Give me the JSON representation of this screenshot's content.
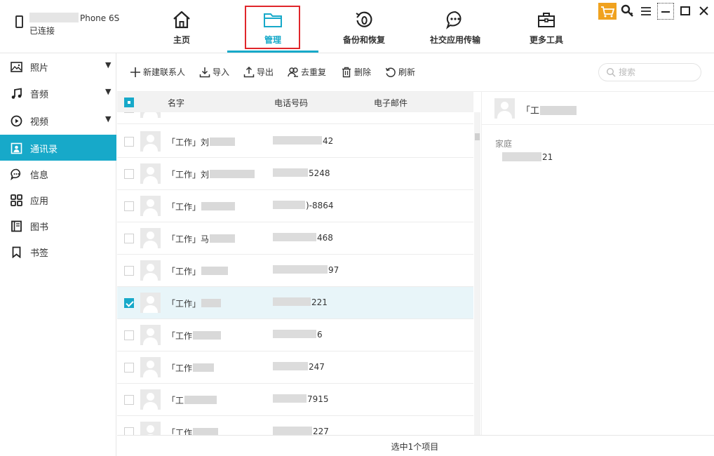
{
  "device": {
    "model": "Phone 6S",
    "status": "已连接"
  },
  "nav_tabs": [
    {
      "label": "主页",
      "icon": "home-icon"
    },
    {
      "label": "管理",
      "icon": "folder-icon"
    },
    {
      "label": "备份和恢复",
      "icon": "backup-restore-icon"
    },
    {
      "label": "社交应用传输",
      "icon": "chat-transfer-icon"
    },
    {
      "label": "更多工具",
      "icon": "toolbox-icon"
    }
  ],
  "active_tab": "管理",
  "window_controls": [
    "cart-icon",
    "key-icon",
    "menu-icon",
    "minimize-icon",
    "maximize-icon",
    "close-icon"
  ],
  "sidebar": {
    "items": [
      {
        "label": "照片",
        "icon": "photo-icon",
        "expandable": true
      },
      {
        "label": "音频",
        "icon": "music-icon",
        "expandable": true
      },
      {
        "label": "视频",
        "icon": "video-icon",
        "expandable": true
      },
      {
        "label": "通讯录",
        "icon": "contacts-icon",
        "expandable": false
      },
      {
        "label": "信息",
        "icon": "message-icon",
        "expandable": false
      },
      {
        "label": "应用",
        "icon": "apps-icon",
        "expandable": false
      },
      {
        "label": "图书",
        "icon": "book-icon",
        "expandable": false
      },
      {
        "label": "书签",
        "icon": "bookmark-icon",
        "expandable": false
      }
    ],
    "active": "通讯录"
  },
  "toolbar": {
    "new_contact": "新建联系人",
    "import": "导入",
    "export": "导出",
    "dedupe": "去重复",
    "delete": "删除",
    "refresh": "刷新",
    "search_placeholder": "搜索"
  },
  "columns": {
    "name": "名字",
    "phone": "电话号码",
    "email": "电子邮件"
  },
  "contacts": [
    {
      "name": "「工作」刘",
      "phone": "42",
      "selected": false
    },
    {
      "name": "「工作」刘",
      "phone": "5248",
      "selected": false
    },
    {
      "name": "「工作」",
      "phone": ")-8864",
      "selected": false
    },
    {
      "name": "「工作」马",
      "phone": "468",
      "selected": false
    },
    {
      "name": "「工作」",
      "phone": "97",
      "selected": false
    },
    {
      "name": "「工作」",
      "phone": "221",
      "selected": true
    },
    {
      "name": "「工作",
      "phone": "6",
      "selected": false
    },
    {
      "name": "「工作",
      "phone": "247",
      "selected": false
    },
    {
      "name": "「工",
      "phone": "7915",
      "selected": false
    },
    {
      "name": "「工作",
      "phone": "227",
      "selected": false
    }
  ],
  "detail": {
    "name": "「工",
    "group": "家庭",
    "phone": "21"
  },
  "status_text": "选中1个项目"
}
